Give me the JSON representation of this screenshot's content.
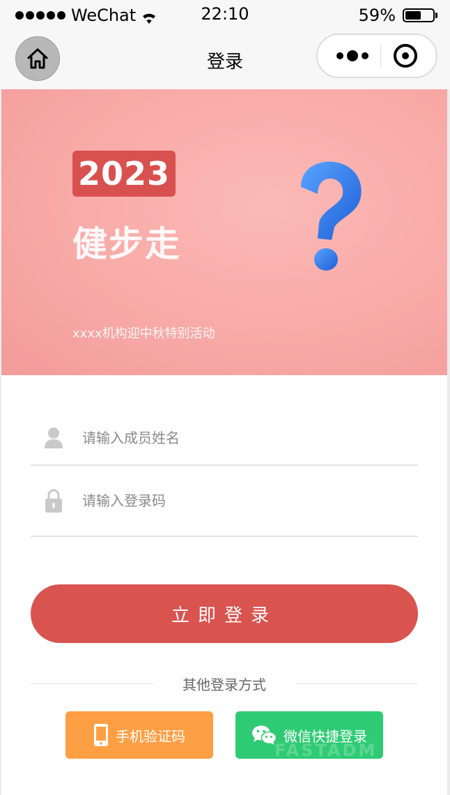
{
  "status_bar": {
    "carrier": "WeChat",
    "time": "22:10",
    "battery": "59%",
    "battery_level": 0.59
  },
  "nav": {
    "title": "登录"
  },
  "banner": {
    "year": "2023",
    "title": "健步走",
    "subtitle": "xxxx机构迎中秋特别活动"
  },
  "form": {
    "name_placeholder": "请输入成员姓名",
    "code_placeholder": "请输入登录码",
    "submit_label": "立即登录"
  },
  "other_login": {
    "label": "其他登录方式",
    "phone_label": "手机验证码",
    "wechat_label": "微信快捷登录"
  },
  "watermark": "FASTADM",
  "colors": {
    "primary": "#d9534f",
    "phone_button": "#ff9f43",
    "wechat_button": "#2fcb74"
  }
}
